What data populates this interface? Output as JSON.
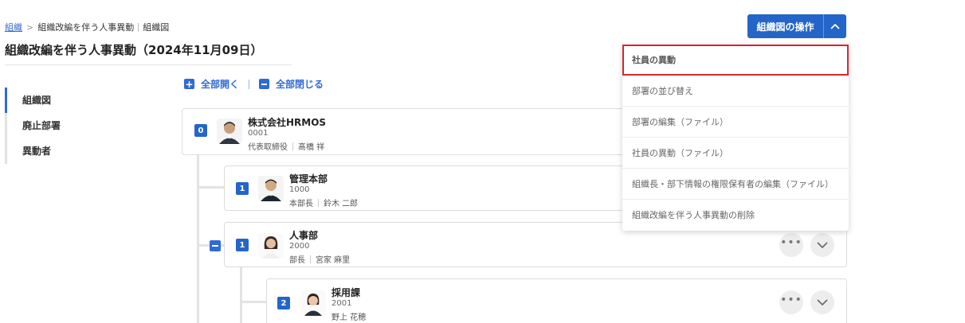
{
  "breadcrumb": {
    "root": "組織",
    "separator": ">",
    "current": "組織改編を伴う人事異動",
    "page": "組織図"
  },
  "page_title": "組織改編を伴う人事異動（2024年11月09日）",
  "sidebar": {
    "items": [
      {
        "label": "組織図",
        "active": true
      },
      {
        "label": "廃止部署",
        "active": false
      },
      {
        "label": "異動者",
        "active": false
      }
    ]
  },
  "tree_controls": {
    "expand_all": "全部開く",
    "collapse_all": "全部閉じる",
    "expand_icon": "+"
  },
  "org_tree": {
    "company": {
      "level": "0",
      "name": "株式会社HRMOS",
      "code": "0001",
      "role": "代表取締役",
      "person": "髙橋 祥"
    },
    "departments": [
      {
        "level": "1",
        "name": "管理本部",
        "code": "1000",
        "role": "本部長",
        "person": "鈴木 二郎"
      },
      {
        "level": "1",
        "name": "人事部",
        "code": "2000",
        "role": "部長",
        "person": "宮家 麻里"
      },
      {
        "level": "2",
        "name": "採用課",
        "code": "2001",
        "role": "",
        "person": "野上 花穂"
      }
    ],
    "more_button_label": "•••"
  },
  "ops_button": {
    "label": "組織図の操作",
    "icon": "chevron-up-icon"
  },
  "ops_menu": {
    "items": [
      {
        "label": "社員の異動",
        "highlighted": true
      },
      {
        "label": "部署の並び替え",
        "highlighted": false
      },
      {
        "label": "部署の編集（ファイル）",
        "highlighted": false
      },
      {
        "label": "社員の異動（ファイル）",
        "highlighted": false
      },
      {
        "label": "組織長・部下情報の権限保有者の編集（ファイル）",
        "highlighted": false
      },
      {
        "label": "組織改編を伴う人事異動の削除",
        "highlighted": false
      }
    ]
  },
  "colors": {
    "accent": "#2465c9",
    "link": "#2f6bd6",
    "highlight_border": "#d9262c"
  }
}
